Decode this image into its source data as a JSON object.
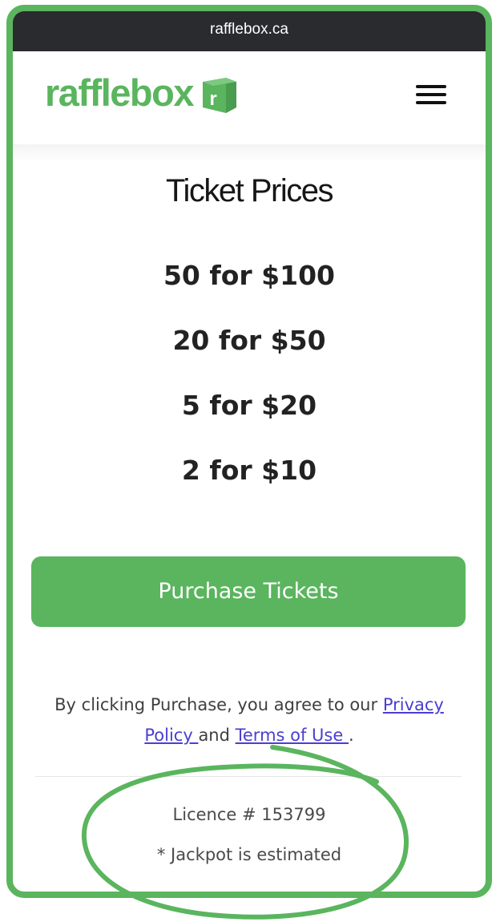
{
  "browser": {
    "url": "rafflebox.ca"
  },
  "header": {
    "logo_text": "rafflebox",
    "logo_badge": "r",
    "menu_icon": "hamburger-menu-icon"
  },
  "main": {
    "title": "Ticket Prices",
    "prices": [
      "50 for $100",
      "20 for $50",
      "5 for $20",
      "2 for $10"
    ],
    "purchase_label": "Purchase Tickets"
  },
  "agreement": {
    "prefix": "By clicking Purchase, you agree to our ",
    "privacy_link": "Privacy Policy ",
    "middle": "and ",
    "terms_link": "Terms of Use ",
    "suffix": "."
  },
  "footer": {
    "licence": "Licence # 153799",
    "jackpot_note": "* Jackpot is estimated"
  },
  "colors": {
    "brand_green": "#5ab55e",
    "url_bar": "#2a2b2e",
    "link": "#4a3fd0"
  }
}
